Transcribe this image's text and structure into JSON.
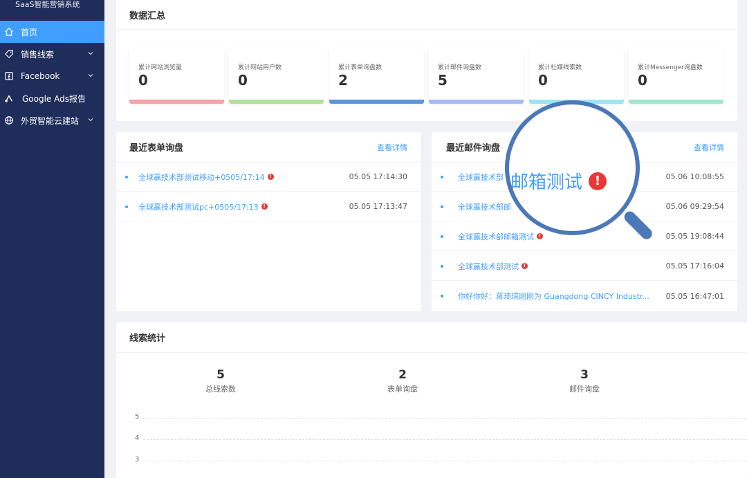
{
  "app": {
    "title": "SaaS智能营销系统"
  },
  "sidebar": {
    "items": [
      {
        "label": "首页",
        "icon": "home-icon",
        "active": true
      },
      {
        "label": "销售线索",
        "icon": "tag-icon",
        "has_arrow": true
      },
      {
        "label": "Facebook",
        "icon": "facebook-icon",
        "has_arrow": true
      },
      {
        "label": "Google Ads报告",
        "icon": "google-ads-icon"
      },
      {
        "label": "外贸智能云建站",
        "icon": "globe-icon",
        "has_arrow": true
      }
    ]
  },
  "summary": {
    "title": "数据汇总",
    "stats": [
      {
        "label": "累计网站浏览量",
        "value": "0",
        "color": "#f4a3a8"
      },
      {
        "label": "累计网站用户数",
        "value": "0",
        "color": "#b5dfa1"
      },
      {
        "label": "累计表单询盘数",
        "value": "2",
        "color": "#5b95dc"
      },
      {
        "label": "累计邮件询盘数",
        "value": "5",
        "color": "#aab8f3"
      },
      {
        "label": "累计社媒线索数",
        "value": "0",
        "color": "#9de4f2"
      },
      {
        "label": "累计Messenger询盘数",
        "value": "0",
        "color": "#9ee6d0"
      }
    ]
  },
  "form_inquiries": {
    "title": "最近表单询盘",
    "detail_label": "查看详情",
    "rows": [
      {
        "text": "全球赢技术部测试移动+0505/17:14",
        "time": "05.05 17:14:30",
        "alert": true
      },
      {
        "text": "全球赢技术部测试pc+0505/17:13",
        "time": "05.05 17:13:47",
        "alert": true
      }
    ]
  },
  "email_inquiries": {
    "title": "最近邮件询盘",
    "detail_label": "查看详情",
    "rows": [
      {
        "text": "全球赢技术部",
        "time": "05.06 10:08:55",
        "alert": false
      },
      {
        "text": "全球赢技术部邮",
        "time": "05.06 09:29:54",
        "alert": false
      },
      {
        "text": "全球赢技术部邮箱测试",
        "time": "05.05 19:08:44",
        "alert": true
      },
      {
        "text": "全球赢技术部测试",
        "time": "05.05 17:16:04",
        "alert": true
      },
      {
        "text": "你好你好：蒋琦琪刚刚为 Guangdong CINCY Industr...",
        "time": "05.05 16:47:01",
        "alert": false
      }
    ]
  },
  "magnifier": {
    "text": "邮箱测试",
    "alert_glyph": "!"
  },
  "leads": {
    "title": "线索统计",
    "stats": [
      {
        "value": "5",
        "label": "总线索数"
      },
      {
        "value": "2",
        "label": "表单询盘"
      },
      {
        "value": "3",
        "label": "邮件询盘"
      }
    ],
    "y_ticks": [
      "5",
      "4",
      "3"
    ]
  }
}
